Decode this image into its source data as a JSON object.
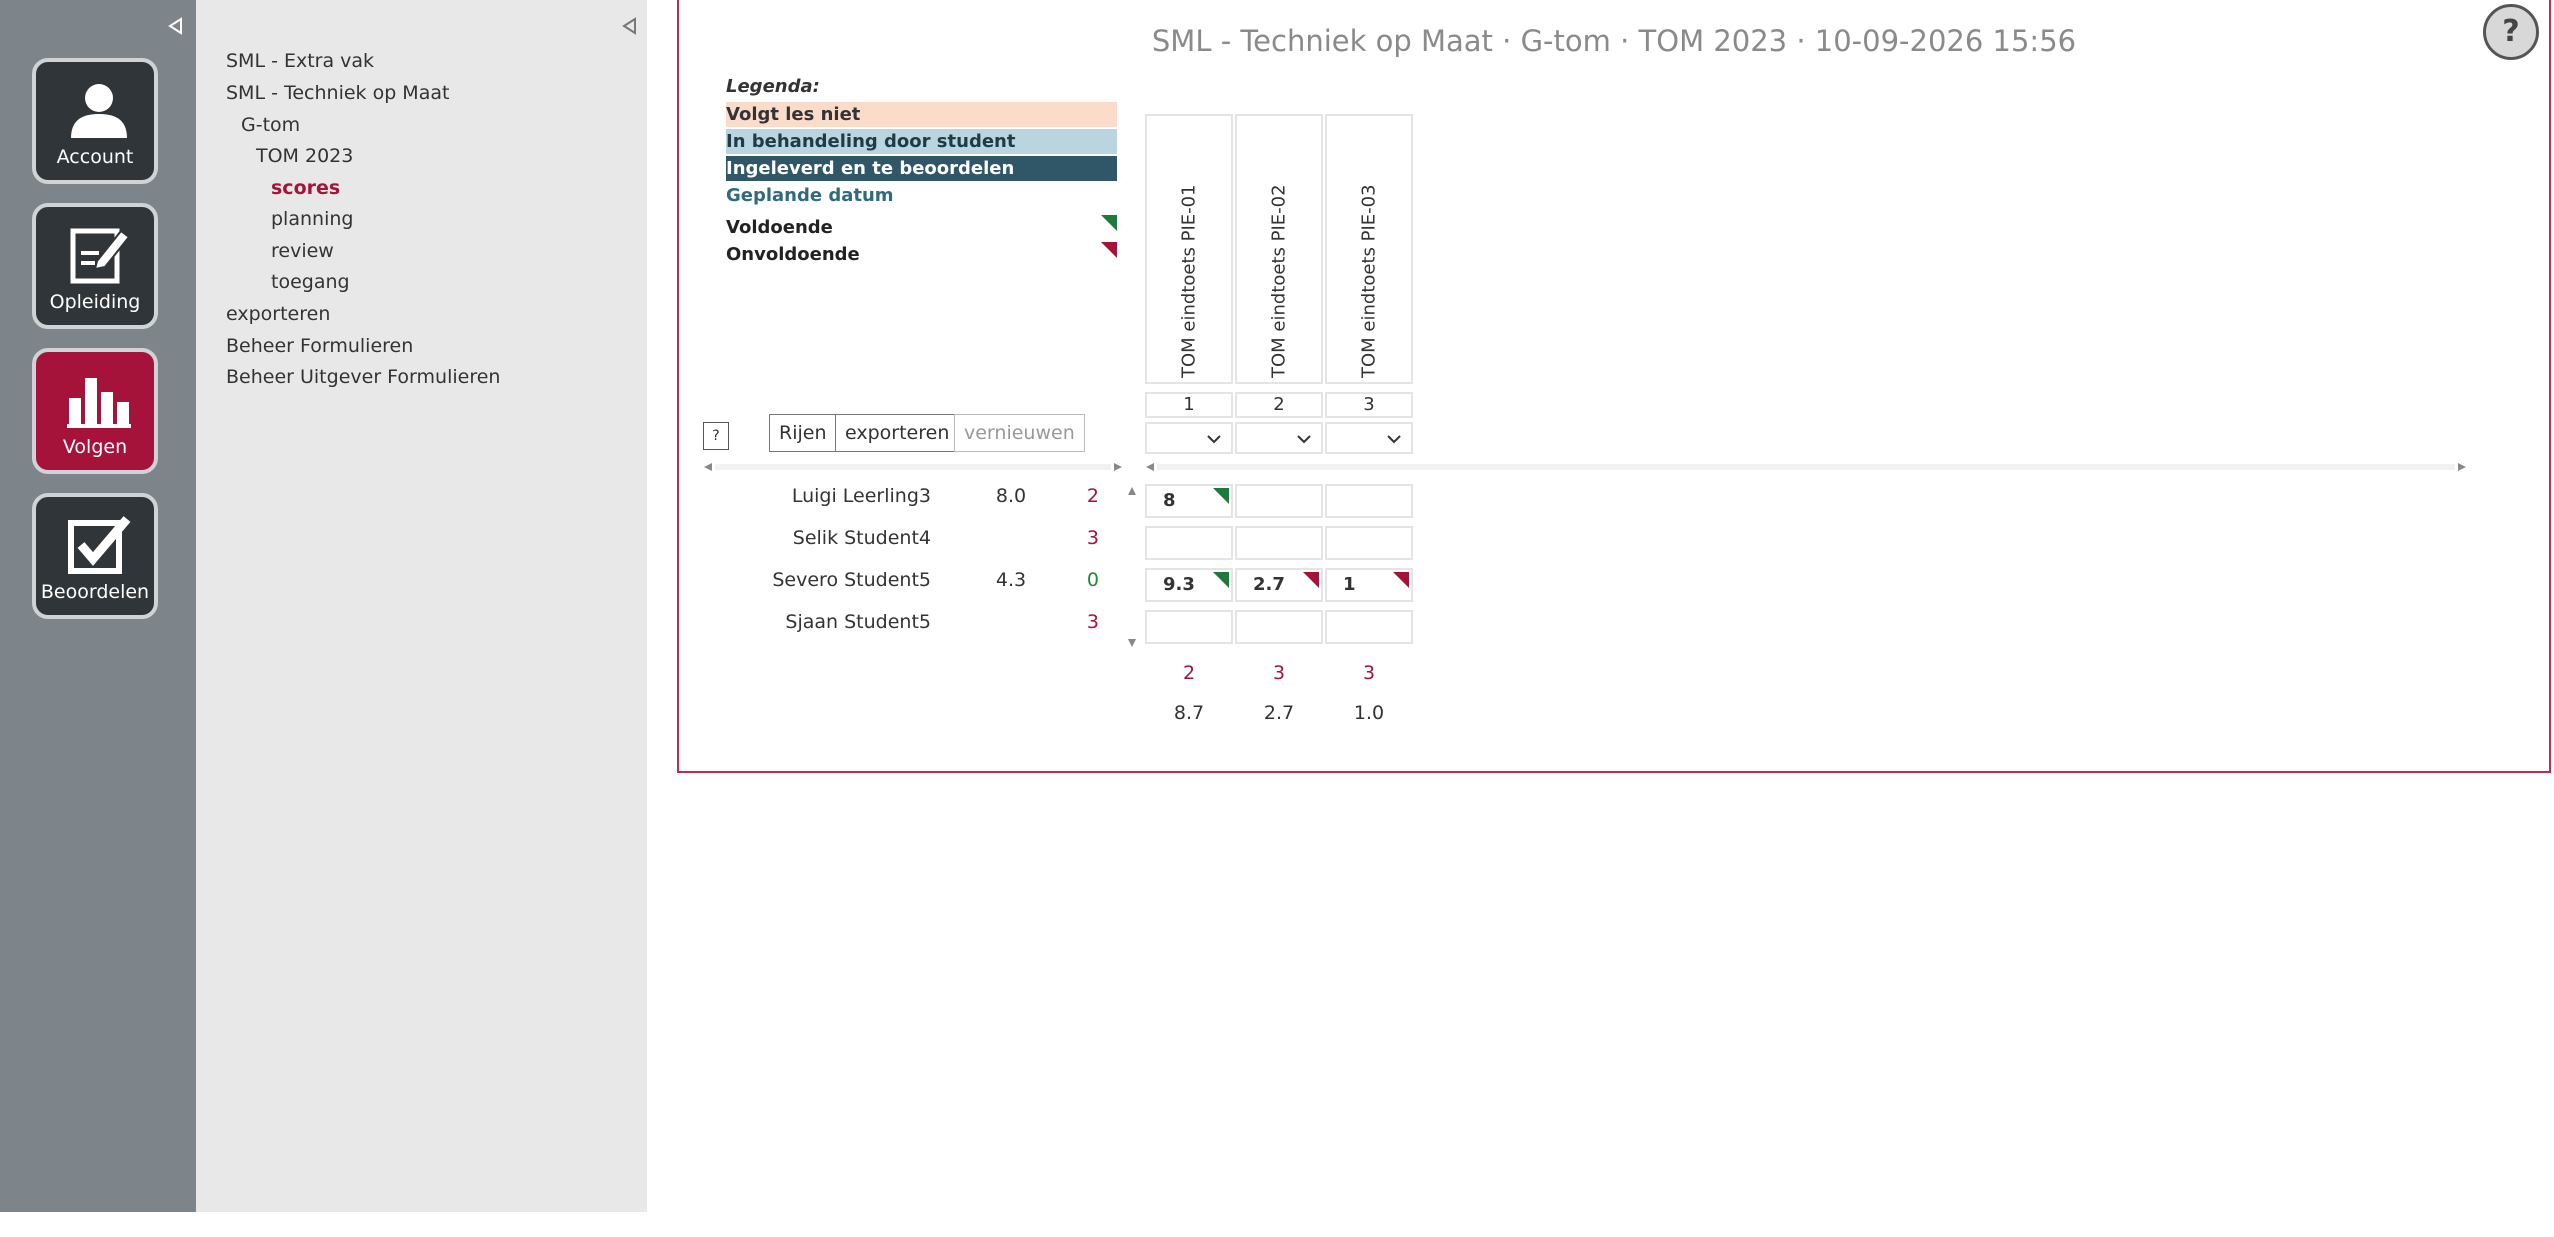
{
  "rail": {
    "items": [
      {
        "label": "Account",
        "icon": "user-icon"
      },
      {
        "label": "Opleiding",
        "icon": "edit-note-icon"
      },
      {
        "label": "Volgen",
        "icon": "bar-chart-icon"
      },
      {
        "label": "Beoordelen",
        "icon": "checkbox-icon"
      }
    ]
  },
  "tree": {
    "items": [
      {
        "label": "SML - Extra vak"
      },
      {
        "label": "SML - Techniek op Maat"
      },
      {
        "label": "G-tom"
      },
      {
        "label": "TOM 2023"
      },
      {
        "label": "scores"
      },
      {
        "label": "planning"
      },
      {
        "label": "review"
      },
      {
        "label": "toegang"
      },
      {
        "label": "exporteren"
      },
      {
        "label": "Beheer Formulieren"
      },
      {
        "label": "Beheer Uitgever Formulieren"
      }
    ]
  },
  "header": {
    "title": "SML - Techniek op Maat · G-tom · TOM 2023 · 10-09-2026 15:56",
    "help_label": "?"
  },
  "legend": {
    "title": "Legenda:",
    "items": [
      {
        "label": "Volgt les niet",
        "color": "#fbdccb"
      },
      {
        "label": "In behandeling door student",
        "color": "#b9d5e0"
      },
      {
        "label": "Ingeleverd en te beoordelen",
        "color": "#2f5767"
      },
      {
        "label": "Geplande datum",
        "color": "#2f6b7a"
      },
      {
        "label": "Voldoende",
        "color": "#1e7a3a"
      },
      {
        "label": "Onvoldoende",
        "color": "#a5123a"
      }
    ]
  },
  "columns": [
    {
      "name": "TOM eindtoets PIE-01",
      "number": "1",
      "fail_count": "2",
      "average": "8.7"
    },
    {
      "name": "TOM eindtoets PIE-02",
      "number": "2",
      "fail_count": "3",
      "average": "2.7"
    },
    {
      "name": "TOM eindtoets PIE-03",
      "number": "3",
      "fail_count": "3",
      "average": "1.0"
    }
  ],
  "toolbar": {
    "help_label": "?",
    "rows_label": "Rijen",
    "export_label": "exporteren",
    "refresh_label": "vernieuwen"
  },
  "rows": [
    {
      "name": "Luigi Leerling3",
      "avg": "8.0",
      "count": "2",
      "count_status": "red",
      "scores": [
        {
          "value": "8",
          "status": "voldoende"
        },
        {
          "value": "",
          "status": ""
        },
        {
          "value": "",
          "status": ""
        }
      ]
    },
    {
      "name": "Selik Student4",
      "avg": "",
      "count": "3",
      "count_status": "red",
      "scores": [
        {
          "value": "",
          "status": ""
        },
        {
          "value": "",
          "status": ""
        },
        {
          "value": "",
          "status": ""
        }
      ]
    },
    {
      "name": "Severo Student5",
      "avg": "4.3",
      "count": "0",
      "count_status": "green",
      "scores": [
        {
          "value": "9.3",
          "status": "voldoende"
        },
        {
          "value": "2.7",
          "status": "onvoldoende"
        },
        {
          "value": "1",
          "status": "onvoldoende"
        }
      ]
    },
    {
      "name": "Sjaan Student5",
      "avg": "",
      "count": "3",
      "count_status": "red",
      "scores": [
        {
          "value": "",
          "status": ""
        },
        {
          "value": "",
          "status": ""
        },
        {
          "value": "",
          "status": ""
        }
      ]
    }
  ]
}
